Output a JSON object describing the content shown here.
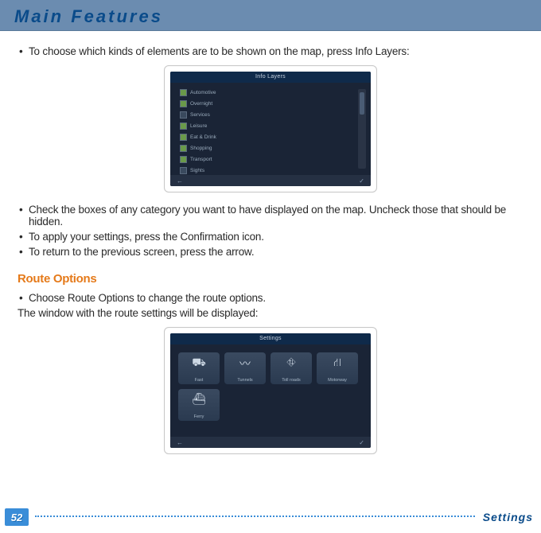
{
  "header": {
    "title": "Main Features"
  },
  "body": {
    "intro_bullet": "To choose which kinds of elements are to be shown on the map, press Info Layers:",
    "bullets_after": [
      "Check the boxes of any category you want to have displayed on the map. Uncheck those that should be hidden.",
      "To apply your settings, press the Confirmation icon.",
      "To return to the previous screen, press the arrow."
    ],
    "route_section_title": "Route Options",
    "route_bullet": "Choose Route Options to change the route options.",
    "route_line": "The window with the route settings will be displayed:"
  },
  "screenshot1": {
    "title": "Info Layers",
    "layers": [
      {
        "label": "Automotive",
        "on": true
      },
      {
        "label": "Overnight",
        "on": true
      },
      {
        "label": "Services",
        "on": false
      },
      {
        "label": "Leisure",
        "on": true
      },
      {
        "label": "Eat & Drink",
        "on": true
      },
      {
        "label": "Shopping",
        "on": true
      },
      {
        "label": "Transport",
        "on": true
      },
      {
        "label": "Sights",
        "on": false
      }
    ],
    "back_glyph": "←",
    "confirm_glyph": "✓"
  },
  "screenshot2": {
    "title": "Settings",
    "tiles": [
      {
        "icon": "⛟",
        "label": "Fast"
      },
      {
        "icon": "〰",
        "label": "Tunnels"
      },
      {
        "icon": "⛗",
        "label": "Toll roads"
      },
      {
        "icon": "⛙",
        "label": "Motorway"
      },
      {
        "icon": "⛴",
        "label": "Ferry"
      }
    ],
    "back_glyph": "←",
    "confirm_glyph": "✓"
  },
  "footer": {
    "page_number": "52",
    "section": "Settings"
  }
}
